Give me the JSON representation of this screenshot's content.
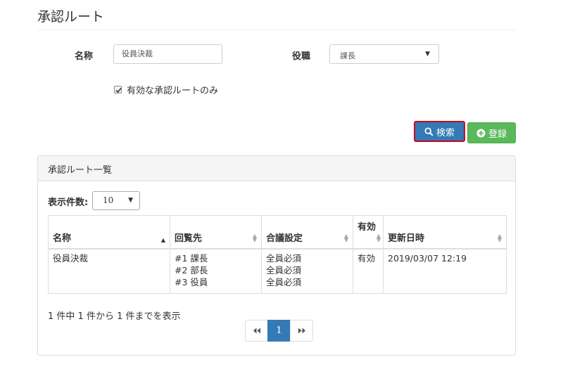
{
  "page": {
    "title": "承認ルート"
  },
  "search": {
    "name_label": "名称",
    "name_value": "役員決裁",
    "role_label": "役職",
    "role_selected": "課長",
    "active_only_label": "有効な承認ルートのみ",
    "active_only_checked": true,
    "search_button": "検索",
    "register_button": "登録"
  },
  "list_panel": {
    "title": "承認ルート一覧",
    "page_length_label": "表示件数:",
    "page_length_value": "10",
    "columns": [
      "名称",
      "回覧先",
      "合議設定",
      "有効",
      "更新日時"
    ],
    "rows": [
      {
        "name": "役員決裁",
        "recipients": [
          "#1 課長",
          "#2 部長",
          "#3 役員"
        ],
        "consultation": [
          "全員必須",
          "全員必須",
          "全員必須"
        ],
        "active": "有効",
        "updated": "2019/03/07 12:19"
      }
    ],
    "info": "1 件中 1 件から 1 件までを表示",
    "pagination": {
      "prev": "«",
      "current": "1",
      "next": "»"
    }
  },
  "colors": {
    "primary": "#337ab7",
    "success": "#5cb85c",
    "highlight": "#d0021b"
  }
}
